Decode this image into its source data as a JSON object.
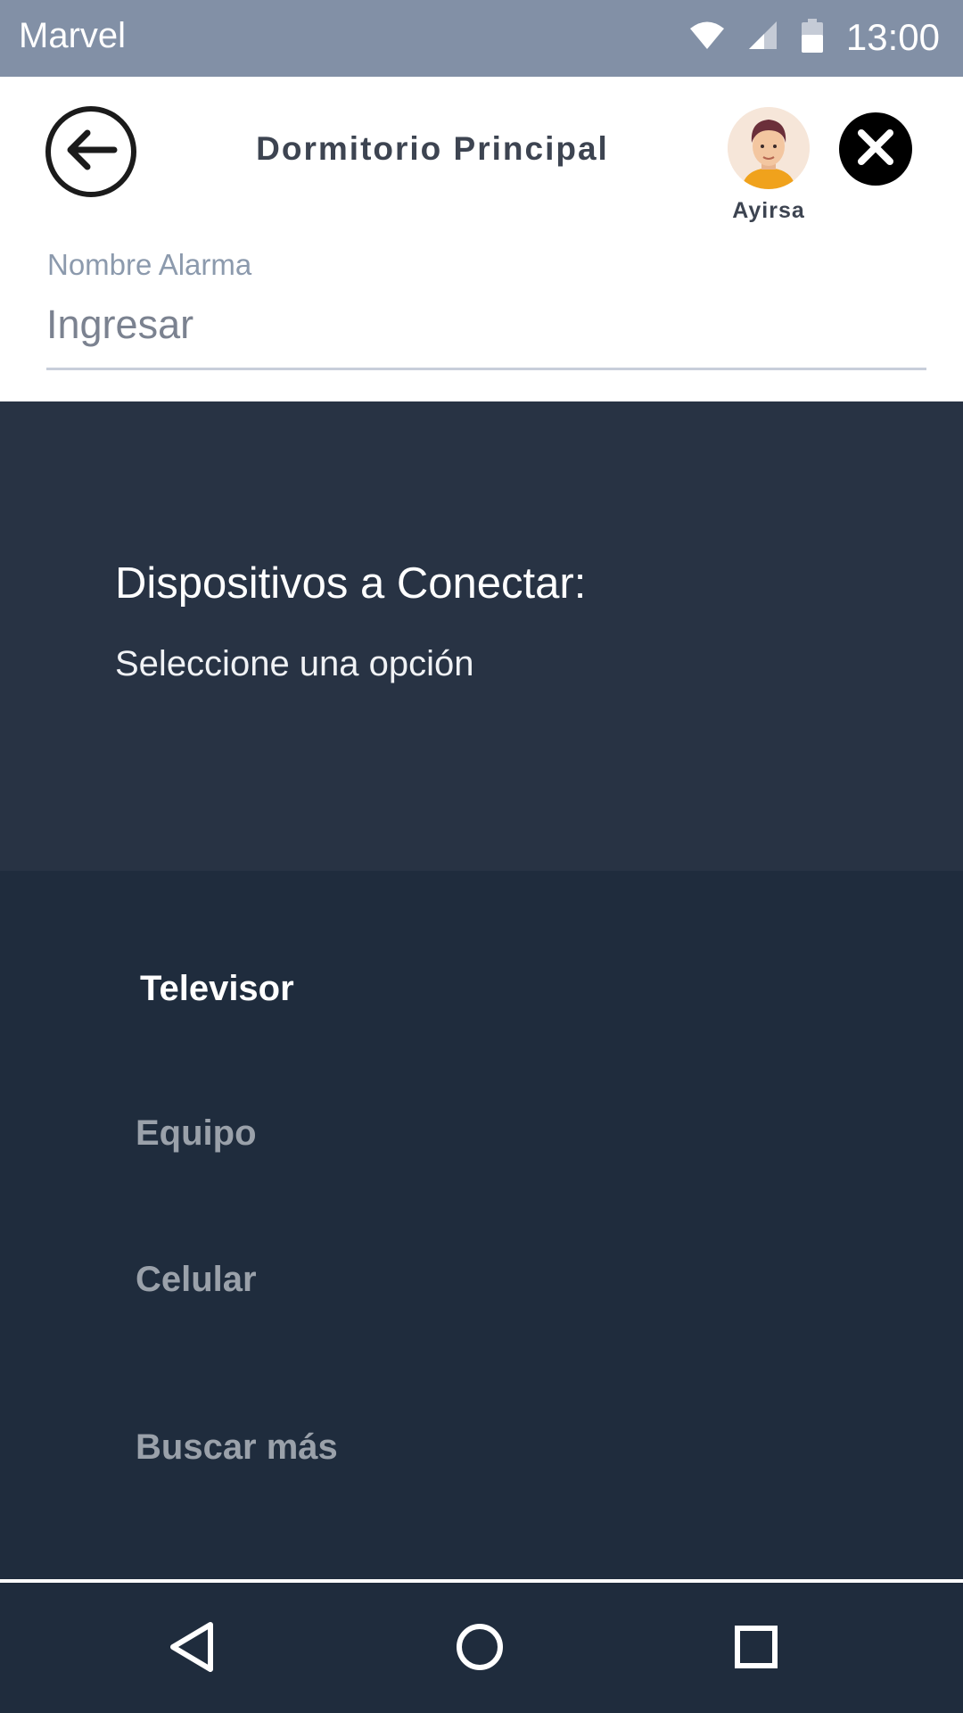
{
  "status_bar": {
    "carrier": "Marvel",
    "time": "13:00",
    "icons": [
      "wifi-icon",
      "signal-icon",
      "battery-icon"
    ]
  },
  "header": {
    "title": "Dormitorio Principal",
    "user_name": "Ayirsa",
    "icons": [
      "back-arrow-icon",
      "close-icon",
      "user-avatar"
    ]
  },
  "form": {
    "label": "Nombre Alarma",
    "placeholder": "Ingresar",
    "value": ""
  },
  "devices": {
    "title": "Dispositivos a Conectar:",
    "subtitle": "Seleccione una opción",
    "options": [
      {
        "label": "Televisor",
        "selected": true
      },
      {
        "label": "Equipo",
        "selected": false
      },
      {
        "label": "Celular",
        "selected": false
      },
      {
        "label": "Buscar más",
        "selected": false
      }
    ]
  },
  "nav": {
    "icons": [
      "nav-back-icon",
      "nav-home-icon",
      "nav-recents-icon"
    ]
  },
  "colors": {
    "status_bar": "#8290a6",
    "panel_top": "#283344",
    "panel_list": "#1f2c3d",
    "title_text": "#3d4451",
    "selected_text": "#ffffff",
    "unselected_text": "#9aa1aa"
  }
}
